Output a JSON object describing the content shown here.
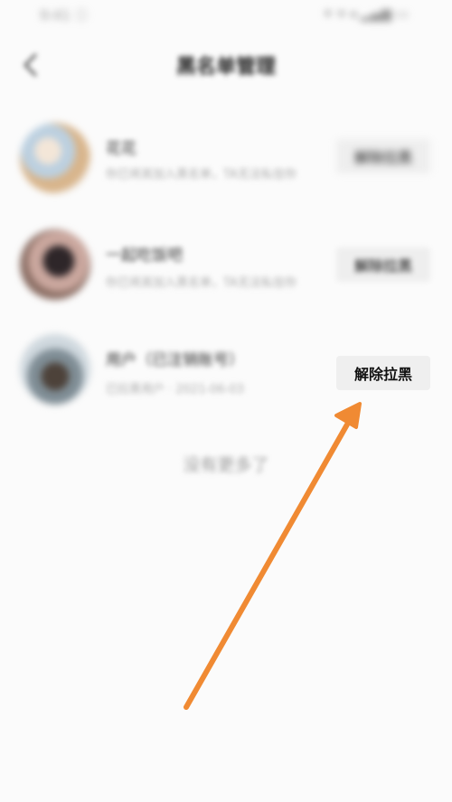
{
  "status_bar": {
    "left_text": "9:41 ⓘ",
    "right_text": "✦ ▾ ◂ ▂▄▆ ▭"
  },
  "nav": {
    "back_icon": "chevron-left-icon",
    "title": "黑名单管理"
  },
  "blocked_users": [
    {
      "name": "花花",
      "subtitle": "你已将其加入黑名单，TA无法私信你",
      "action_label": "解除拉黑",
      "avatar_colors": [
        "#e9d6c6",
        "#b8c9d9",
        "#d6b48a"
      ]
    },
    {
      "name": "一起吃饭吧",
      "subtitle": "你已将其加入黑名单，TA无法私信你",
      "action_label": "解除拉黑",
      "avatar_colors": [
        "#3b3336",
        "#d7b5ad",
        "#8a6f66"
      ]
    },
    {
      "name": "用户（已注销账号）",
      "subtitle": "已拉黑用户 · 2021-06-03",
      "action_label": "解除拉黑",
      "avatar_colors": [
        "#6f7c84",
        "#c8d2d9",
        "#4a3f36"
      ]
    }
  ],
  "footer_note": "没有更多了",
  "annotation": {
    "arrow_color": "#f08a33",
    "arrow_icon": "arrow-pointer-icon"
  }
}
